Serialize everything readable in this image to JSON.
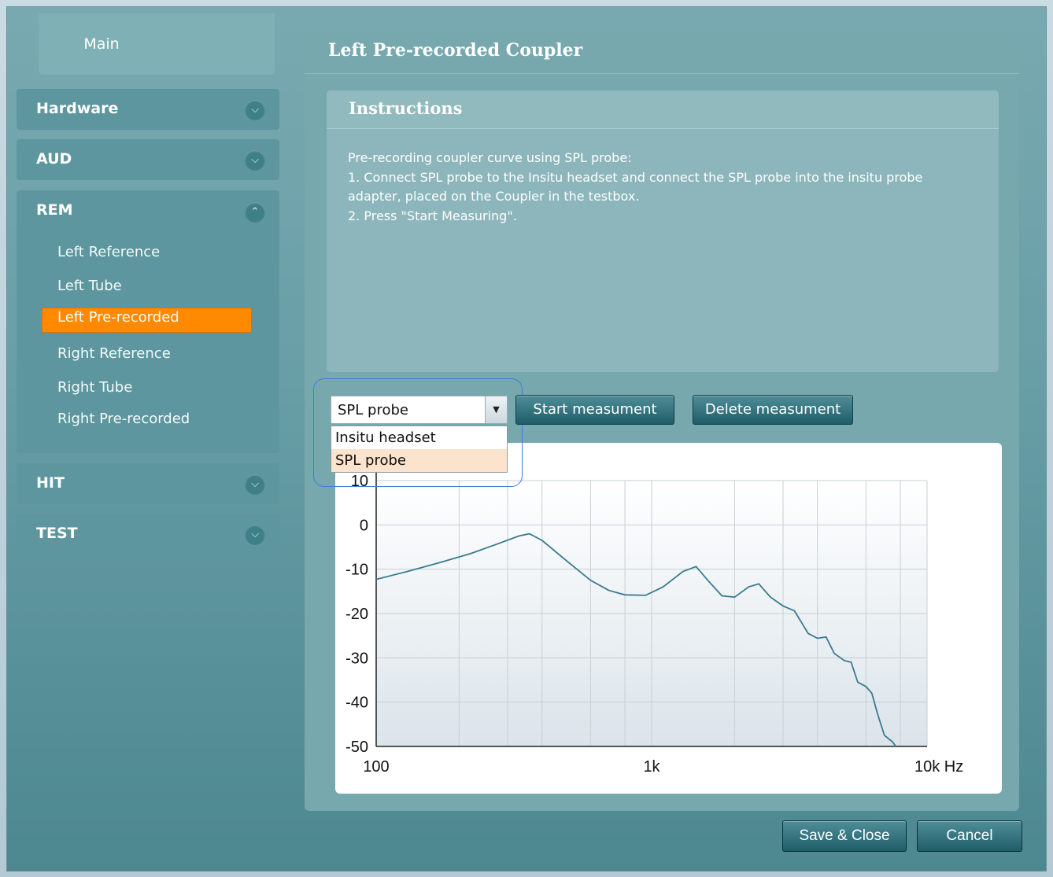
{
  "sidebar": {
    "main_label": "Main",
    "groups": [
      {
        "label": "Hardware",
        "state": "collapsed"
      },
      {
        "label": "AUD",
        "state": "collapsed"
      },
      {
        "label": "REM",
        "state": "expanded"
      },
      {
        "label": "HIT",
        "state": "collapsed"
      },
      {
        "label": "TEST",
        "state": "collapsed"
      }
    ],
    "rem_items": [
      "Left Reference",
      "Left Tube",
      "Left Pre-recorded",
      "Right Reference",
      "Right Tube",
      "Right Pre-recorded"
    ],
    "active_item": "Left Pre-recorded"
  },
  "panel": {
    "title": "Left Pre-recorded Coupler",
    "instructions_title": "Instructions",
    "instructions_text": "Pre-recording coupler curve using SPL probe:\n1. Connect SPL probe to the Insitu headset and connect the SPL probe into the insitu probe adapter, placed on the Coupler in the testbox.\n2. Press \"Start Measuring\"."
  },
  "combo": {
    "value": "SPL probe",
    "options": [
      "Insitu headset",
      "SPL probe"
    ],
    "selected": "SPL probe"
  },
  "buttons": {
    "start": "Start measument",
    "delete": "Delete measument",
    "save_close": "Save & Close",
    "cancel": "Cancel"
  },
  "colors": {
    "accent_active": "#ff8a00",
    "curve": "#3a7a90",
    "background": "#6a9fa7"
  },
  "chart_data": {
    "type": "line",
    "x_scale": "log",
    "xlim": [
      100,
      10000
    ],
    "ylim": [
      -50,
      10
    ],
    "x_ticks": [
      {
        "value": 100,
        "label": "100"
      },
      {
        "value": 1000,
        "label": "1k"
      },
      {
        "value": 10000,
        "label": "10k Hz"
      }
    ],
    "y_ticks": [
      10,
      0,
      -10,
      -20,
      -30,
      -40,
      -50
    ],
    "grid": true,
    "series": [
      {
        "points": [
          [
            100,
            -12.3
          ],
          [
            130,
            -10.5
          ],
          [
            170,
            -8.5
          ],
          [
            220,
            -6.5
          ],
          [
            270,
            -4.5
          ],
          [
            330,
            -2.5
          ],
          [
            360,
            -2.0
          ],
          [
            400,
            -3.5
          ],
          [
            500,
            -8.5
          ],
          [
            600,
            -12.5
          ],
          [
            700,
            -14.8
          ],
          [
            800,
            -15.8
          ],
          [
            950,
            -15.9
          ],
          [
            1100,
            -14.0
          ],
          [
            1300,
            -10.5
          ],
          [
            1450,
            -9.4
          ],
          [
            1600,
            -12.5
          ],
          [
            1800,
            -16.0
          ],
          [
            2000,
            -16.3
          ],
          [
            2250,
            -14.0
          ],
          [
            2450,
            -13.3
          ],
          [
            2700,
            -16.3
          ],
          [
            3000,
            -18.3
          ],
          [
            3300,
            -19.4
          ],
          [
            3700,
            -24.5
          ],
          [
            4000,
            -25.6
          ],
          [
            4300,
            -25.3
          ],
          [
            4600,
            -29.0
          ],
          [
            5000,
            -30.6
          ],
          [
            5300,
            -31.0
          ],
          [
            5600,
            -35.5
          ],
          [
            6000,
            -36.5
          ],
          [
            6300,
            -38.0
          ],
          [
            6600,
            -42.5
          ],
          [
            7000,
            -47.5
          ],
          [
            7500,
            -49.0
          ],
          [
            7700,
            -50.0
          ]
        ]
      }
    ]
  }
}
